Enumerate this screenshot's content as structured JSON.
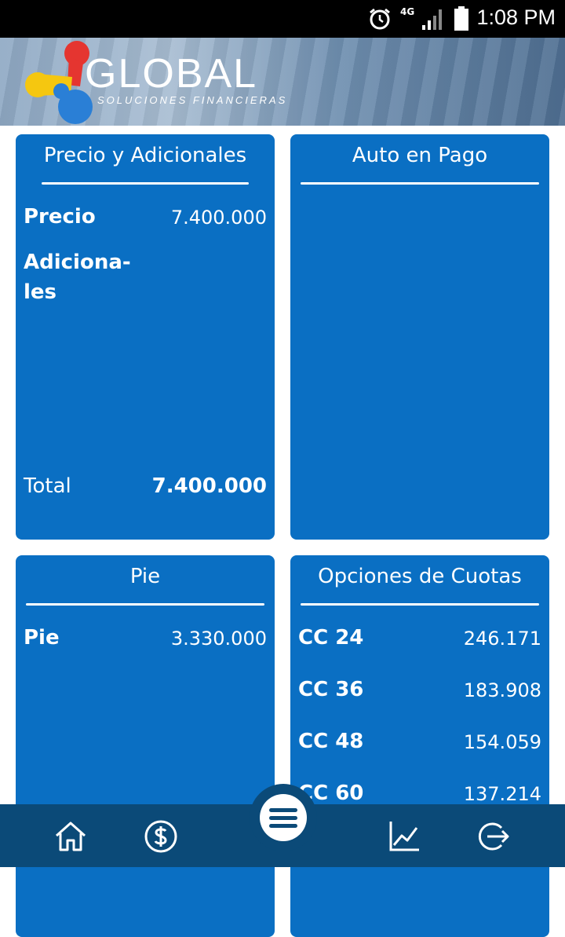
{
  "status_bar": {
    "time": "1:08 PM",
    "network": "4G"
  },
  "brand": {
    "name": "GLOBAL",
    "tagline": "SOLUCIONES FINANCIERAS"
  },
  "cards": {
    "precio": {
      "title": "Precio y Adicionales",
      "rows": [
        {
          "label": "Precio",
          "value": "7.400.000"
        },
        {
          "label": "Adiciona-",
          "value": ""
        }
      ],
      "label_cutoff": "les",
      "total_label": "Total",
      "total_value": "7.400.000"
    },
    "auto": {
      "title": "Auto en Pago"
    },
    "pie": {
      "title": "Pie",
      "rows": [
        {
          "label": "Pie",
          "value": "3.330.000"
        }
      ]
    },
    "cuotas": {
      "title": "Opciones de Cuotas",
      "rows": [
        {
          "label": "CC 24",
          "value": "246.171"
        },
        {
          "label": "CC 36",
          "value": "183.908"
        },
        {
          "label": "CC 48",
          "value": "154.059"
        },
        {
          "label": "CC 60",
          "value": "137.214"
        }
      ]
    }
  },
  "nav": {
    "items": [
      {
        "icon": "home-icon"
      },
      {
        "icon": "dollar-icon"
      },
      {
        "icon": "menu-icon"
      },
      {
        "icon": "chart-icon"
      },
      {
        "icon": "logout-icon"
      }
    ]
  },
  "colors": {
    "card": "#0a6fc3",
    "nav": "#0b4a78",
    "status_bar": "#000000"
  }
}
